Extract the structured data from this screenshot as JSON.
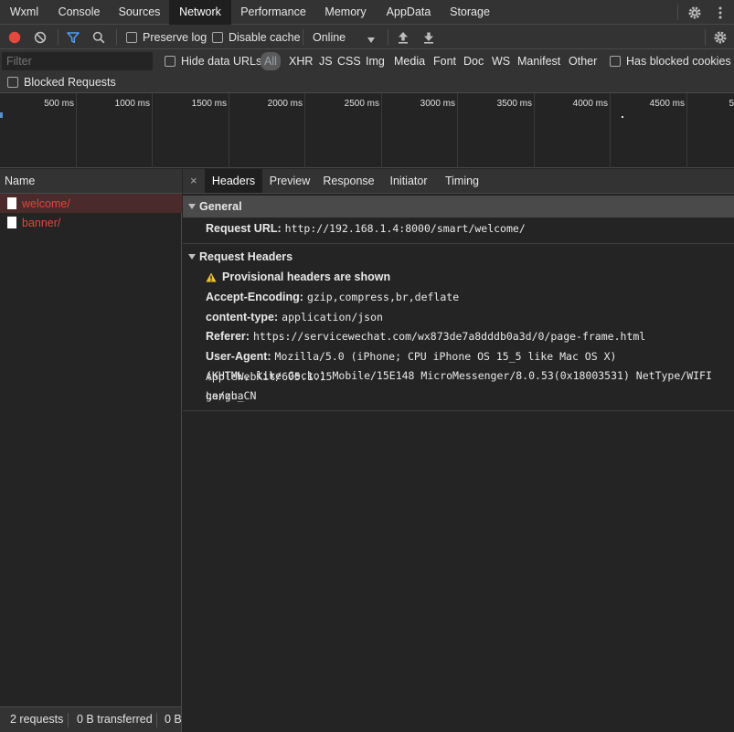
{
  "top_tabs": [
    "Wxml",
    "Console",
    "Sources",
    "Network",
    "Performance",
    "Memory",
    "AppData",
    "Storage"
  ],
  "active_top_tab": "Network",
  "toolbar": {
    "preserve_log": "Preserve log",
    "disable_cache": "Disable cache",
    "throttle": "Online"
  },
  "filter": {
    "placeholder": "Filter",
    "hide_data_urls": "Hide data URLs",
    "types": [
      "All",
      "XHR",
      "JS",
      "CSS",
      "Img",
      "Media",
      "Font",
      "Doc",
      "WS",
      "Manifest",
      "Other"
    ],
    "has_blocked_cookies": "Has blocked cookies",
    "blocked_requests": "Blocked Requests"
  },
  "timeline": {
    "ticks": [
      "500 ms",
      "1000 ms",
      "1500 ms",
      "2000 ms",
      "2500 ms",
      "3000 ms",
      "3500 ms",
      "4000 ms",
      "4500 ms",
      "5"
    ]
  },
  "requests": {
    "header": "Name",
    "items": [
      "welcome/",
      "banner/"
    ]
  },
  "status": {
    "requests": "2 requests",
    "transferred": "0 B transferred",
    "resources": "0 B"
  },
  "detail": {
    "close_glyph": "×",
    "tabs": [
      "Headers",
      "Preview",
      "Response",
      "Initiator",
      "Timing"
    ],
    "active_tab": "Headers",
    "general": {
      "title": "General",
      "request_url_key": "Request URL:",
      "request_url_val": "http://192.168.1.4:8000/smart/welcome/"
    },
    "request_headers": {
      "title": "Request Headers",
      "provisional": "Provisional headers are shown",
      "accept_encoding_key": "Accept-Encoding:",
      "accept_encoding_val": "gzip,compress,br,deflate",
      "content_type_key": "content-type:",
      "content_type_val": "application/json",
      "referer_key": "Referer:",
      "referer_val": "https://servicewechat.com/wx873de7a8dddb0a3d/0/page-frame.html",
      "user_agent_key": "User-Agent:",
      "user_agent_val_1": "Mozilla/5.0 (iPhone; CPU iPhone OS 15_5 like Mac OS X) AppleWebKit/605.1.15",
      "user_agent_val_2": "(KHTML, like Gecko) Mobile/15E148 MicroMessenger/8.0.53(0x18003531) NetType/WIFI Langua",
      "user_agent_val_3": "ge/zh_CN"
    }
  },
  "colors": {
    "record": "#e5483f",
    "filter_icon": "#4f9ef7",
    "request_text": "#e0473f",
    "warning": "#f2c230"
  }
}
